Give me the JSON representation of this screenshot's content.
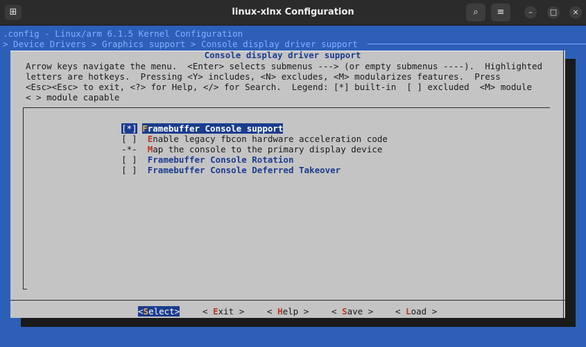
{
  "window": {
    "title": "linux-xlnx Configuration",
    "menu_glyph": "⊞",
    "search_glyph": "⌕",
    "hamburger_glyph": "≡",
    "minimize_glyph": "–",
    "maximize_glyph": "□",
    "close_glyph": "×"
  },
  "terminal": {
    "line1": ".config - Linux/arm 6.1.5 Kernel Configuration",
    "line2": "> Device Drivers > Graphics support > Console display driver support"
  },
  "dialog": {
    "title": "Console display driver support",
    "help": [
      "Arrow keys navigate the menu.  <Enter> selects submenus ---> (or empty submenus ----).  Highlighted",
      "letters are hotkeys.  Pressing <Y> includes, <N> excludes, <M> modularizes features.  Press",
      "<Esc><Esc> to exit, <?> for Help, </> for Search.  Legend: [*] built-in  [ ] excluded  <M> module",
      "< > module capable"
    ],
    "items": [
      {
        "mark": "[*]",
        "hot": "F",
        "rest": "ramebuffer Console support",
        "selected": true
      },
      {
        "mark": "[ ]",
        "hot": "E",
        "rest": "nable legacy fbcon hardware acceleration code"
      },
      {
        "mark": "-*-",
        "hot": "M",
        "rest": "ap the console to the primary display device"
      },
      {
        "mark": "[ ]",
        "hot": "F",
        "rest": "ramebuffer Console Rotation"
      },
      {
        "mark": "[ ]",
        "hot": "F",
        "rest": "ramebuffer Console Deferred Takeover"
      }
    ],
    "buttons": {
      "select": {
        "open": "<",
        "hot": "S",
        "rest": "elect",
        "close": ">"
      },
      "exit": {
        "open": "< ",
        "hot": "E",
        "rest": "xit",
        "close": " >"
      },
      "help": {
        "open": "< ",
        "hot": "H",
        "rest": "elp",
        "close": " >"
      },
      "save": {
        "open": "< ",
        "hot": "S",
        "rest": "ave",
        "close": " >"
      },
      "load": {
        "open": "< ",
        "hot": "L",
        "rest": "oad",
        "close": " >"
      }
    }
  }
}
